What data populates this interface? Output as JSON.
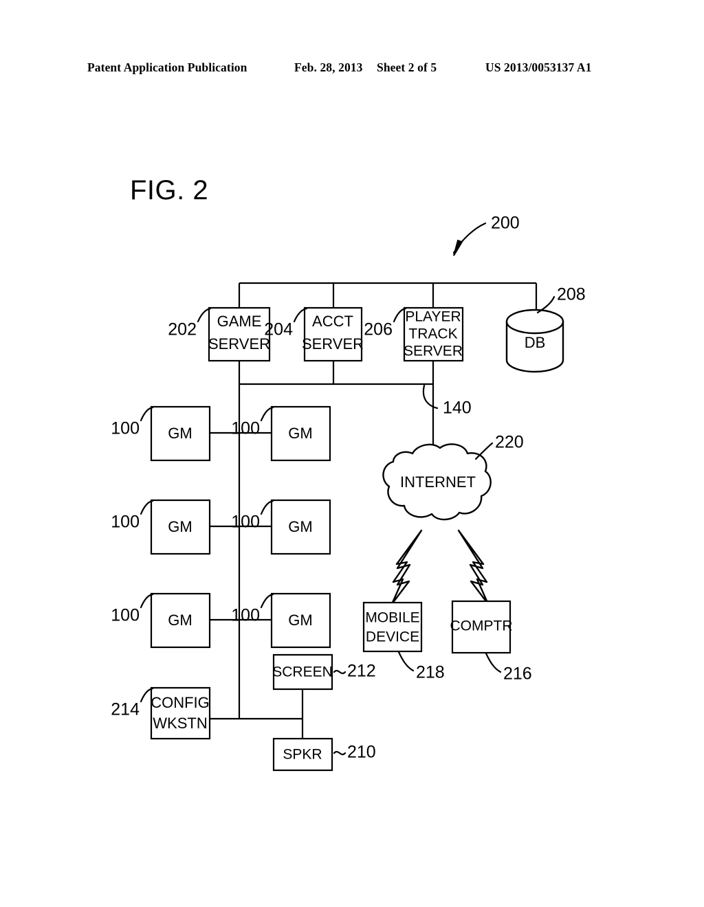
{
  "header": {
    "publication": "Patent Application Publication",
    "date": "Feb. 28, 2013",
    "sheet": "Sheet 2 of 5",
    "number": "US 2013/0053137 A1"
  },
  "figure": {
    "title": "FIG. 2",
    "system_ref": "200"
  },
  "nodes": {
    "game_server": {
      "label_line1": "GAME",
      "label_line2": "SERVER",
      "ref": "202"
    },
    "acct_server": {
      "label_line1": "ACCT",
      "label_line2": "SERVER",
      "ref": "204"
    },
    "player_track": {
      "label_line1": "PLAYER",
      "label_line2": "TRACK",
      "label_line3": "SERVER",
      "ref": "206"
    },
    "database": {
      "label": "DB",
      "ref": "208"
    },
    "network_bus": {
      "ref": "140"
    },
    "internet": {
      "label": "INTERNET",
      "ref": "220"
    },
    "mobile_device": {
      "label_line1": "MOBILE",
      "label_line2": "DEVICE",
      "ref": "218"
    },
    "computer": {
      "label": "COMPTR",
      "ref": "216"
    },
    "screen": {
      "label": "SCREEN",
      "ref": "212"
    },
    "speaker": {
      "label": "SPKR",
      "ref": "210"
    },
    "config_wkstn": {
      "label_line1": "CONFIG",
      "label_line2": "WKSTN",
      "ref": "214"
    }
  },
  "gaming_machines": [
    {
      "label": "GM",
      "ref": "100"
    },
    {
      "label": "GM",
      "ref": "100"
    },
    {
      "label": "GM",
      "ref": "100"
    },
    {
      "label": "GM",
      "ref": "100"
    },
    {
      "label": "GM",
      "ref": "100"
    },
    {
      "label": "GM",
      "ref": "100"
    }
  ],
  "colors": {
    "ink": "#000000",
    "paper": "#ffffff"
  }
}
